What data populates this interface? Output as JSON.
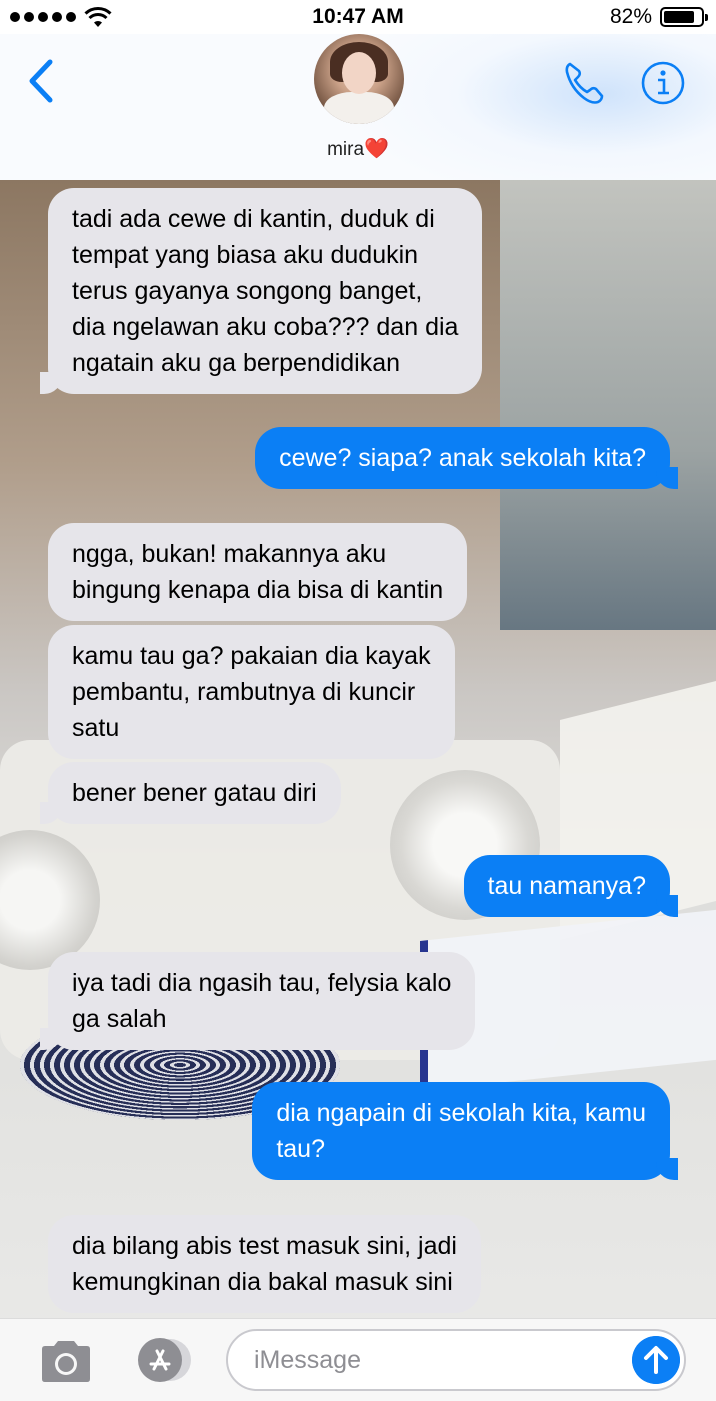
{
  "status_bar": {
    "time": "10:47 AM",
    "battery_text": "82%",
    "battery_level": 0.82,
    "signal_bars": 5
  },
  "header": {
    "contact_name": "mira",
    "contact_emoji": "❤️",
    "back_icon": "chevron-left-icon",
    "call_icon": "phone-icon",
    "info_icon": "info-icon"
  },
  "messages": [
    {
      "side": "incoming",
      "text": "tadi ada cewe di kantin, duduk di\ntempat yang biasa aku dudukin\nterus gayanya songong banget,\ndia ngelawan aku coba??? dan dia\nngatain aku ga berpendidikan"
    },
    {
      "side": "outgoing",
      "text": "cewe? siapa? anak sekolah kita?"
    },
    {
      "side": "incoming",
      "text": "ngga, bukan! makannya aku\nbingung kenapa dia bisa di kantin"
    },
    {
      "side": "incoming",
      "text": "kamu tau ga? pakaian dia kayak\npembantu, rambutnya di kuncir\nsatu"
    },
    {
      "side": "incoming",
      "text": "bener bener gatau diri"
    },
    {
      "side": "outgoing",
      "text": "tau namanya?"
    },
    {
      "side": "incoming",
      "text": "iya tadi dia ngasih tau, felysia kalo\nga salah"
    },
    {
      "side": "outgoing",
      "text": "dia ngapain di sekolah kita, kamu\ntau?"
    },
    {
      "side": "incoming",
      "text": "dia bilang abis test masuk sini, jadi\nkemungkinan dia bakal masuk sini"
    }
  ],
  "input_bar": {
    "placeholder": "iMessage",
    "camera_icon": "camera-icon",
    "apps_icon": "app-store-icon",
    "send_icon": "arrow-up-icon"
  },
  "colors": {
    "accent": "#0b7ff5",
    "incoming_bubble": "#e6e5ea"
  }
}
